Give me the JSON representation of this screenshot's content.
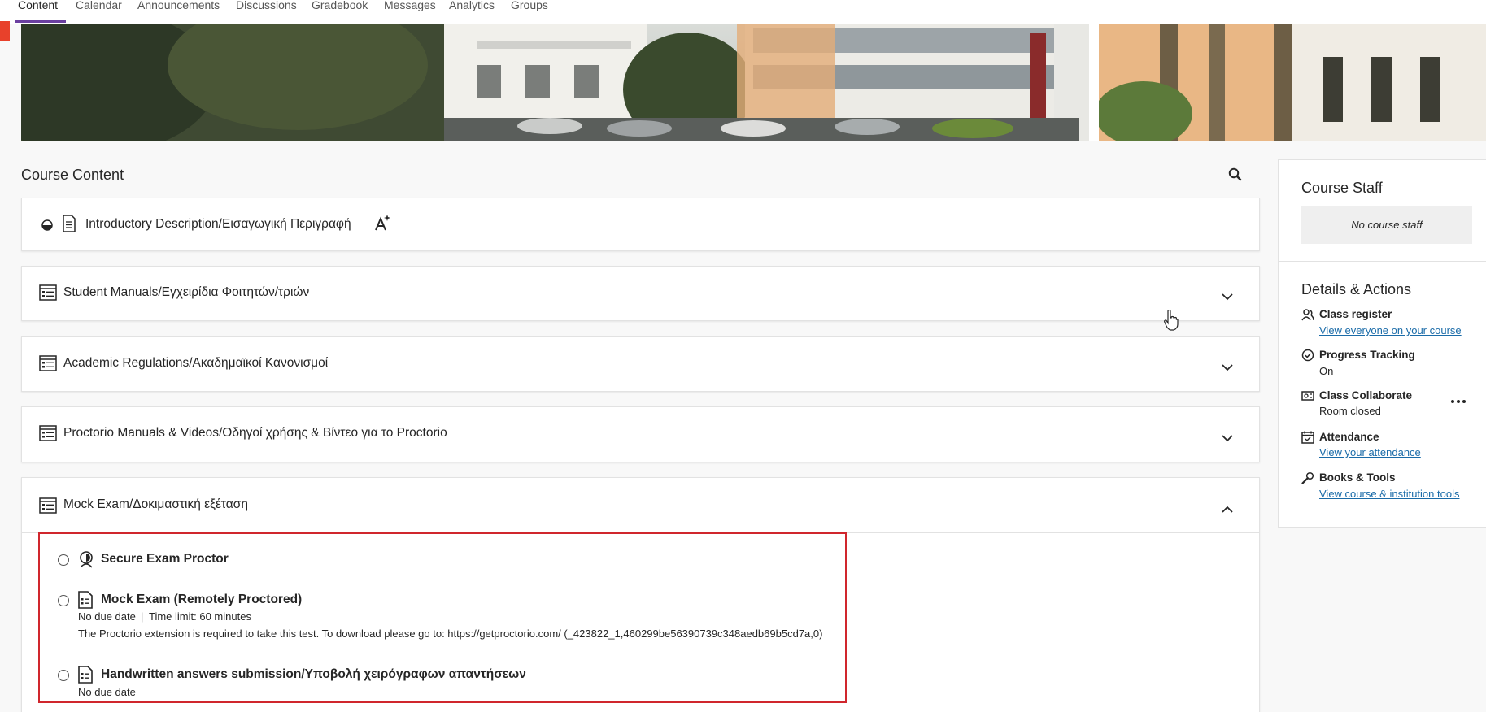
{
  "nav": {
    "tabs": [
      "Content",
      "Calendar",
      "Announcements",
      "Discussions",
      "Gradebook",
      "Messages",
      "Analytics",
      "Groups"
    ],
    "active": "Content"
  },
  "content": {
    "title": "Course Content",
    "sections": [
      {
        "label": "Introductory Description/Εισαγωγική Περιγραφή",
        "icon": "document-icon"
      },
      {
        "label": "Student Manuals/Εγχειρίδια Φοιτητών/τριών",
        "icon": "folder-list-icon"
      },
      {
        "label": "Academic Regulations/Ακαδημαϊκοί Κανονισμοί",
        "icon": "folder-list-icon"
      },
      {
        "label": "Proctorio Manuals & Videos/Οδηγοί χρήσης & Βίντεο για το Proctorio",
        "icon": "folder-list-icon"
      },
      {
        "label": "Mock Exam/Δοκιμαστική εξέταση",
        "icon": "folder-list-icon"
      }
    ],
    "items": [
      {
        "title": "Secure Exam Proctor",
        "icon": "proctor-icon"
      },
      {
        "title": "Mock Exam (Remotely Proctored)",
        "due": "No due date",
        "sep": "|",
        "limit": "Time limit: 60 minutes",
        "desc": "The Proctorio extension is required to take this test. To download please go to: https://getproctorio.com/ (_423822_1,460299be56390739c348aedb69b5cd7a,0)",
        "icon": "test-icon"
      },
      {
        "title": "Handwritten answers submission/Υποβολή χειρόγραφων απαντήσεων",
        "due": "No due date",
        "icon": "assignment-icon"
      }
    ]
  },
  "side": {
    "staff_title": "Course Staff",
    "no_staff": "No course staff",
    "details_title": "Details & Actions",
    "rows": [
      {
        "name": "Class register",
        "link": "View everyone on your course",
        "icon": "people-icon"
      },
      {
        "name": "Progress Tracking",
        "value": "On",
        "icon": "check-circle-icon"
      },
      {
        "name": "Class Collaborate",
        "value": "Room closed",
        "icon": "video-icon"
      },
      {
        "name": "Attendance",
        "link": "View your attendance",
        "icon": "attendance-icon"
      },
      {
        "name": "Books & Tools",
        "link": "View course & institution tools",
        "icon": "wrench-icon"
      }
    ]
  },
  "colors": {
    "accent": "#6b3fa0",
    "highlight": "#d0262d",
    "link": "#1a6ba8",
    "marker": "#e8412b"
  }
}
